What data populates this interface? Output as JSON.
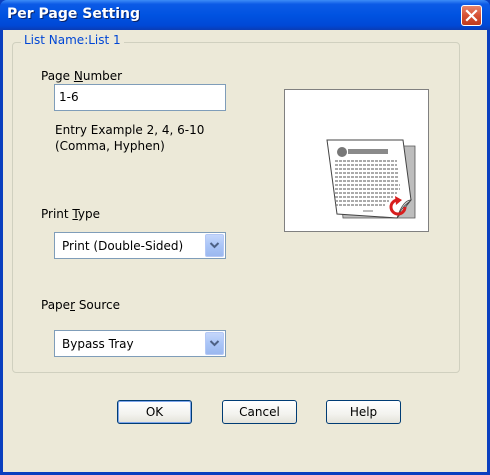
{
  "window": {
    "title": "Per Page Setting"
  },
  "group": {
    "title": "List Name:List 1"
  },
  "page_number": {
    "label_before": "Page ",
    "label_mnemonic": "N",
    "label_after": "umber",
    "value": "1-6",
    "hint_line1": "Entry Example 2, 4, 6-10",
    "hint_line2": "(Comma, Hyphen)"
  },
  "print_type": {
    "label_before": "Print ",
    "label_mnemonic": "T",
    "label_after": "ype",
    "value": "Print (Double-Sided)"
  },
  "paper_source": {
    "label_before": "Pape",
    "label_mnemonic": "r",
    "label_after": " Source",
    "value": "Bypass Tray"
  },
  "buttons": {
    "ok": "OK",
    "cancel": "Cancel",
    "help": "Help"
  },
  "icons": {
    "close": "close-icon",
    "dropdown": "chevron-down-icon",
    "preview": "double-sided-page-icon"
  },
  "colors": {
    "titlebar": "#0054e3",
    "accent": "#0046d5",
    "face": "#ece9d8",
    "close": "#d65134"
  }
}
